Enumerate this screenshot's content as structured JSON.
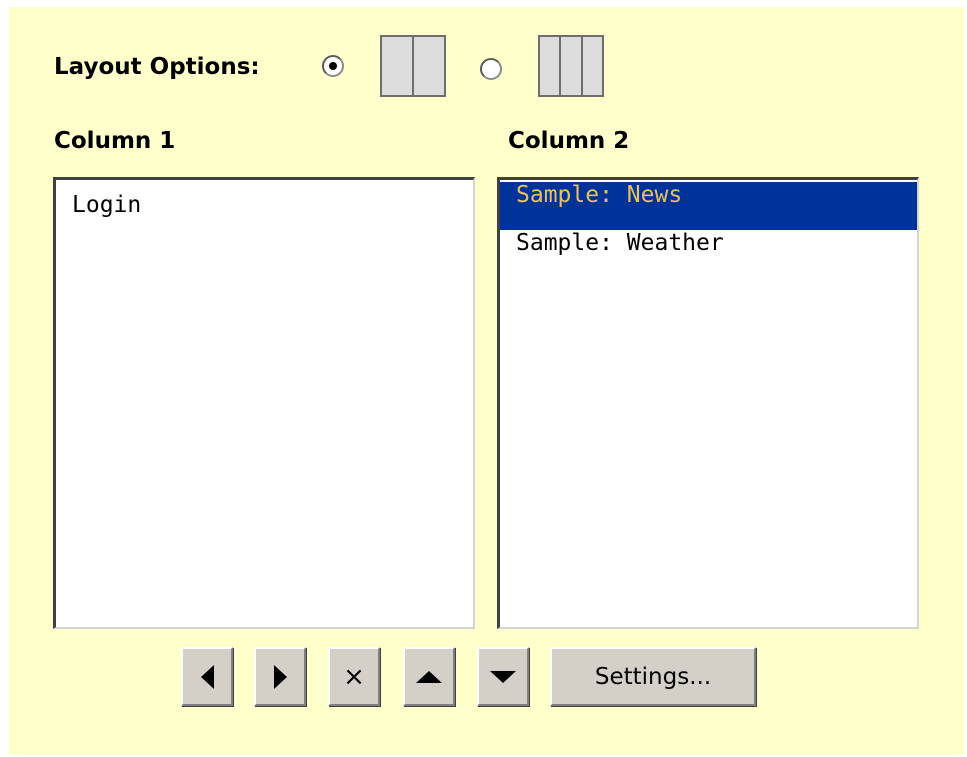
{
  "layout_options": {
    "label": "Layout Options:",
    "options": [
      {
        "id": "two-column",
        "checked": true
      },
      {
        "id": "three-column",
        "checked": false
      }
    ]
  },
  "columns": [
    {
      "heading": "Column 1",
      "items": [
        {
          "label": "Login",
          "selected": false
        }
      ]
    },
    {
      "heading": "Column 2",
      "items": [
        {
          "label": "Sample: News",
          "selected": true
        },
        {
          "label": "Sample: Weather",
          "selected": false
        }
      ]
    }
  ],
  "toolbar": {
    "move_left_icon": "triangle-left-icon",
    "move_right_icon": "triangle-right-icon",
    "remove_label": "×",
    "move_up_icon": "triangle-up-icon",
    "move_down_icon": "triangle-down-icon",
    "settings_label": "Settings..."
  },
  "colors": {
    "panel_background": "#ffffcc",
    "selection_background": "#003399",
    "selection_text": "#e8c060",
    "button_face": "#d4d0c8"
  }
}
